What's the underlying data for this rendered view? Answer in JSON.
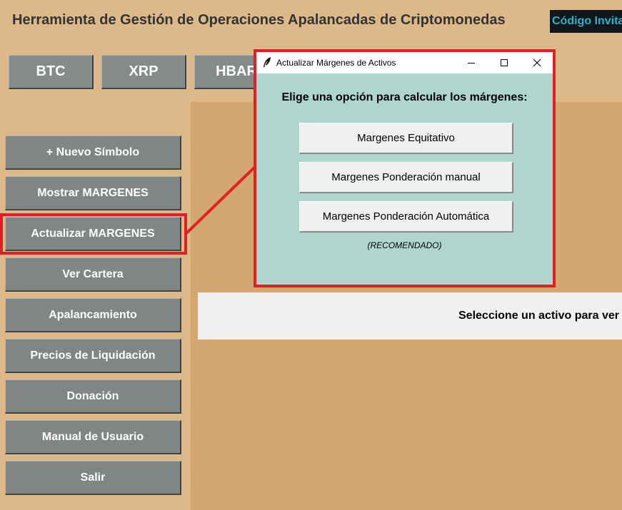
{
  "app": {
    "title": "Herramienta de Gestión de Operaciones Apalancadas de Criptomonedas",
    "invite_label": "Código Invitación"
  },
  "symbols": [
    "BTC",
    "XRP",
    "HBAR"
  ],
  "sidebar": {
    "items": [
      {
        "label": "+ Nuevo Símbolo"
      },
      {
        "label": "Mostrar MARGENES"
      },
      {
        "label": "Actualizar MARGENES"
      },
      {
        "label": "Ver Cartera"
      },
      {
        "label": "Apalancamiento"
      },
      {
        "label": "Precios de Liquidación"
      },
      {
        "label": "Donación"
      },
      {
        "label": "Manual de Usuario"
      },
      {
        "label": "Salir"
      }
    ]
  },
  "main": {
    "info_text": "Seleccione un activo para ver su información"
  },
  "dialog": {
    "title": "Actualizar Márgenes de Activos",
    "heading": "Elige una opción para calcular los márgenes:",
    "options": [
      {
        "label": "Margenes Equitativo"
      },
      {
        "label": "Margenes Ponderación manual"
      },
      {
        "label": "Margenes Ponderación Automática"
      }
    ],
    "recommended_note": "(RECOMENDADO)"
  },
  "colors": {
    "background": "#ddb888",
    "panel": "#d4a670",
    "button": "#808585",
    "highlight": "#e31e24",
    "dialog_bg": "#afd5cf",
    "invite_text": "#29b4c8"
  },
  "icons": {
    "dialog_app_icon": "feather-icon",
    "minimize": "minimize-icon",
    "maximize": "maximize-icon",
    "close": "close-icon"
  }
}
